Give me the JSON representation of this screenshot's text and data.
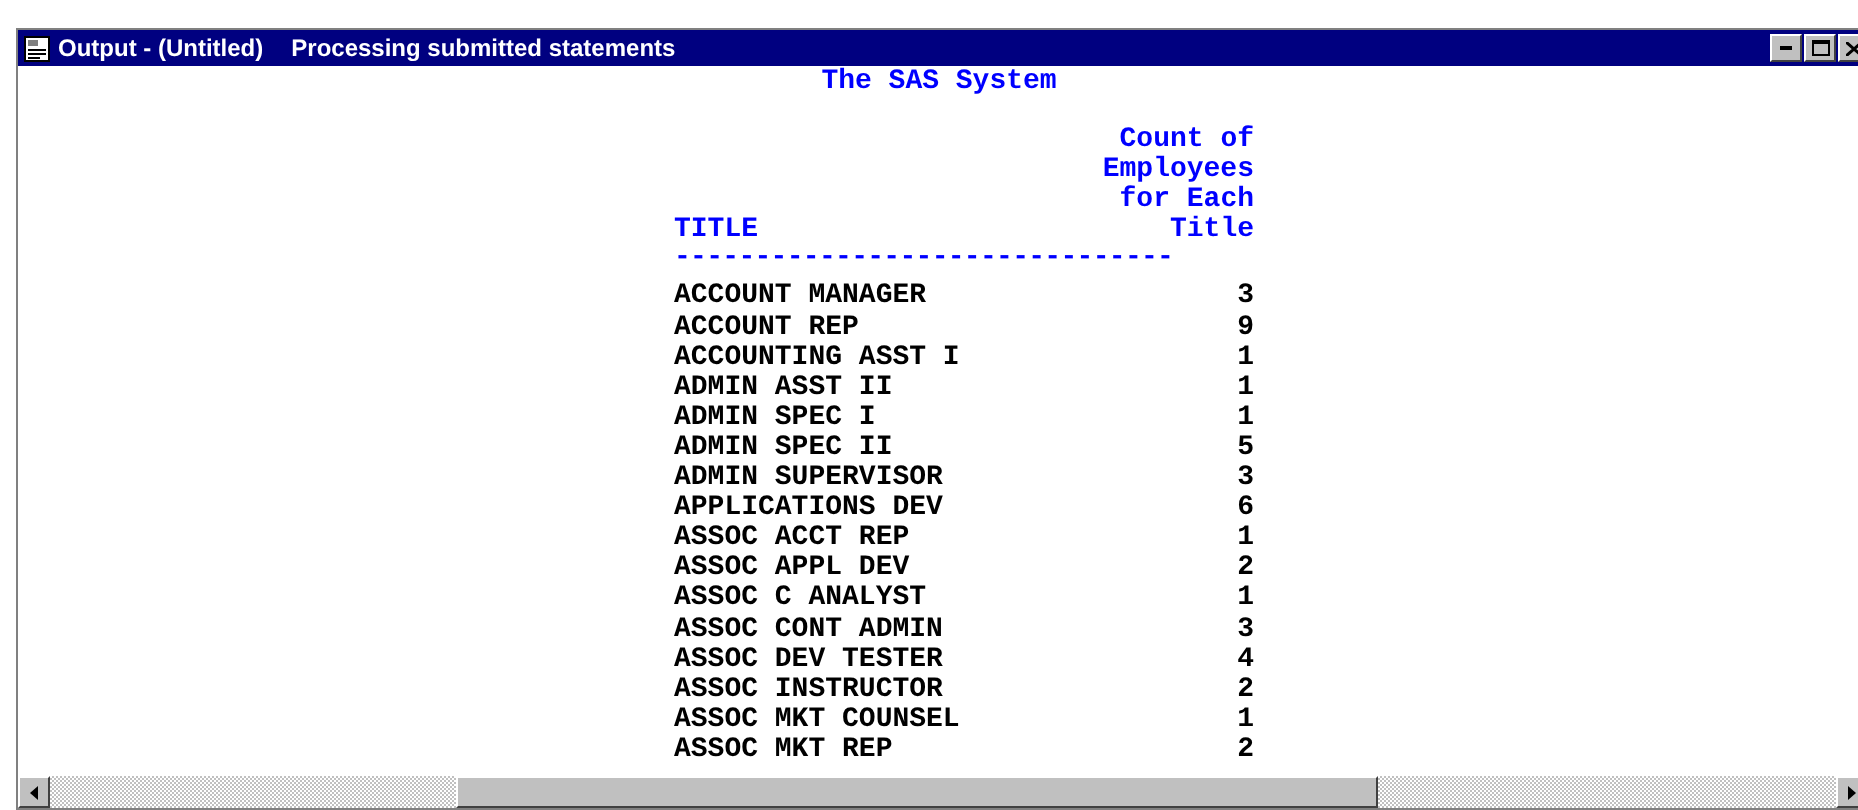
{
  "window": {
    "title": "Output - (Untitled)",
    "status": "Processing submitted statements"
  },
  "output": {
    "heading": "The SAS System",
    "columns": [
      {
        "lines": [
          "TITLE"
        ]
      },
      {
        "lines": [
          "Count of",
          "Employees",
          "for Each",
          "Title"
        ]
      }
    ],
    "separator": "-------------------------------",
    "rows": [
      {
        "title": "ACCOUNT MANAGER",
        "count": "3"
      },
      {
        "title": "ACCOUNT REP",
        "count": "9"
      },
      {
        "title": "ACCOUNTING ASST I",
        "count": "1"
      },
      {
        "title": "ADMIN ASST II",
        "count": "1"
      },
      {
        "title": "ADMIN SPEC I",
        "count": "1"
      },
      {
        "title": "ADMIN SPEC II",
        "count": "5"
      },
      {
        "title": "ADMIN SUPERVISOR",
        "count": "3"
      },
      {
        "title": "APPLICATIONS DEV",
        "count": "6"
      },
      {
        "title": "ASSOC ACCT REP",
        "count": "1"
      },
      {
        "title": "ASSOC APPL DEV",
        "count": "2"
      },
      {
        "title": "ASSOC C ANALYST",
        "count": "1"
      },
      {
        "title": "ASSOC CONT ADMIN",
        "count": "3"
      },
      {
        "title": "ASSOC DEV TESTER",
        "count": "4"
      },
      {
        "title": "ASSOC INSTRUCTOR",
        "count": "2"
      },
      {
        "title": "ASSOC MKT COUNSEL",
        "count": "1"
      },
      {
        "title": "ASSOC MKT REP",
        "count": "2"
      }
    ]
  }
}
